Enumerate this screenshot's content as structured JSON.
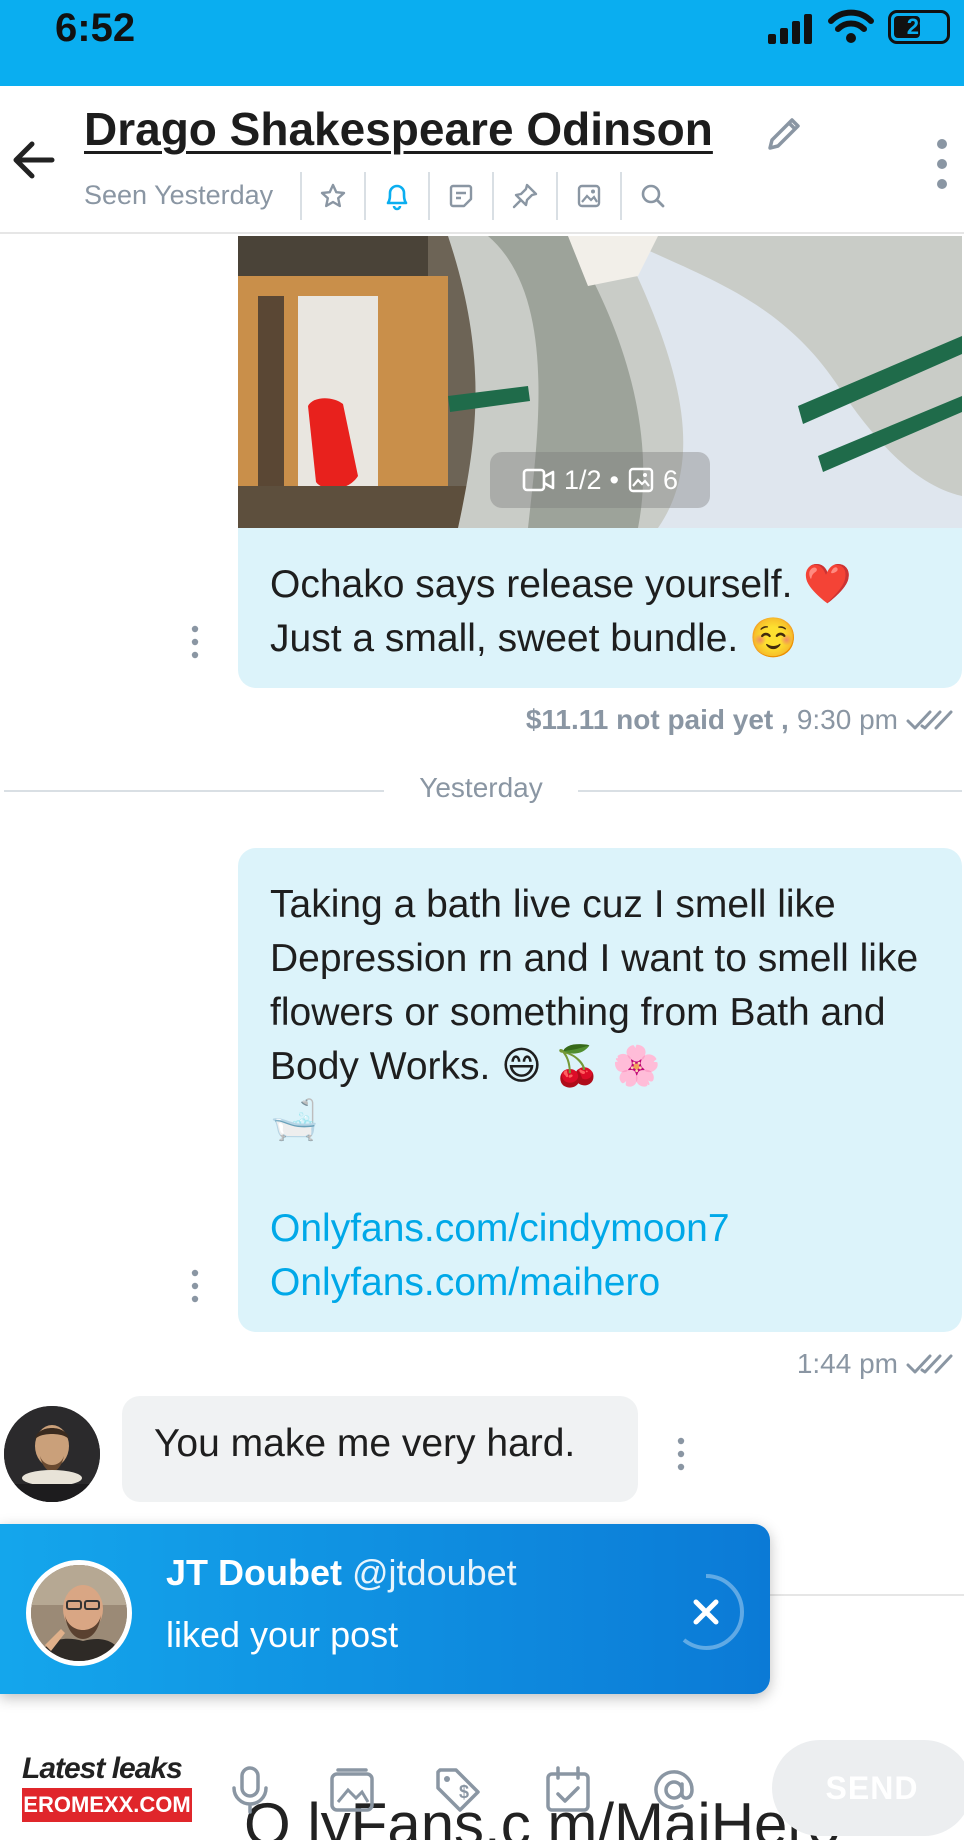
{
  "status_bar": {
    "time": "6:52",
    "battery": "29"
  },
  "header": {
    "title": "Drago Shakespeare Odinson",
    "seen": "Seen Yesterday",
    "tools": [
      "star-icon",
      "bell-icon",
      "note-icon",
      "pin-icon",
      "image-icon",
      "search-icon"
    ]
  },
  "messages": {
    "media": {
      "video_count": "1/2",
      "separator": "•",
      "photo_count": "6"
    },
    "msg1": {
      "text": "Ochako says release yourself. ❤️\nJust a small, sweet bundle. ☺️",
      "price": "$11.11 not paid yet ,",
      "time": "9:30 pm"
    },
    "divider": "Yesterday",
    "msg2": {
      "text": "Taking a bath live cuz I smell like Depression rn and I want to smell like flowers or something from Bath and Body Works. 😄 🍒 🌸\n🛁",
      "link1": "Onlyfans.com/cindymoon7",
      "link2": "Onlyfans.com/maihero",
      "time": "1:44 pm"
    },
    "msg3": {
      "text": "You make me very hard."
    }
  },
  "toast": {
    "name": "JT Doubet",
    "handle": "@jtdoubet",
    "action": "liked your post"
  },
  "composer": {
    "draft": "O lyFans.c m/MaiHero",
    "send": "SEND"
  },
  "watermark": {
    "top": "Latest leaks",
    "bottom": "EROMEXX.COM"
  },
  "colors": {
    "accent": "#0aaef0",
    "bubble_out": "#dcf3fa",
    "bubble_in": "#f0f2f3",
    "link": "#00a8e8",
    "meta": "#8a96a3"
  }
}
